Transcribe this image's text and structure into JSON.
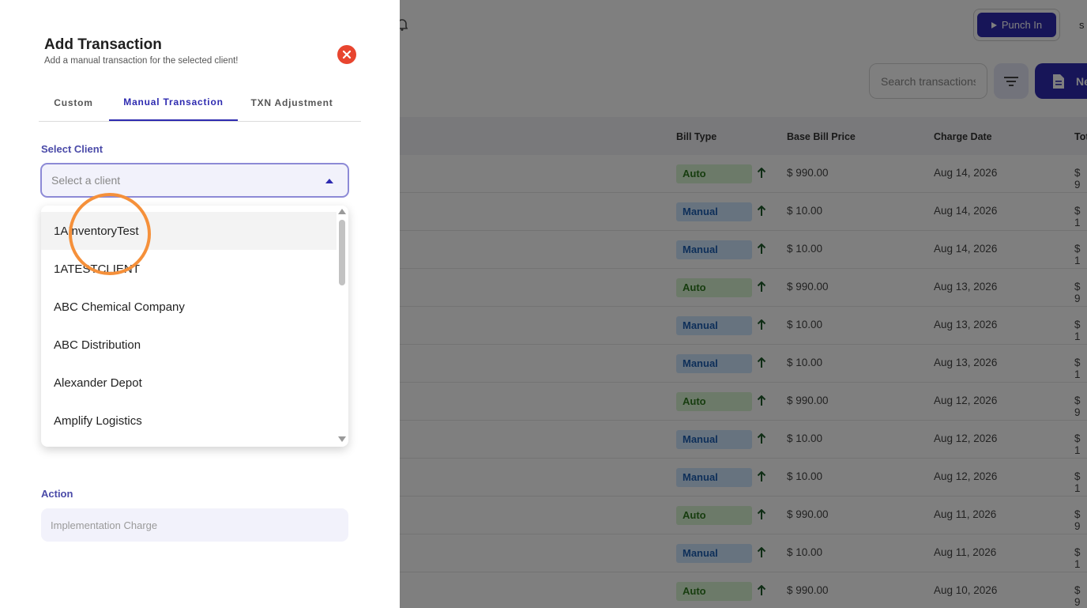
{
  "background_app": {
    "punch_in_label": "Punch In",
    "user_initial": "s",
    "search_placeholder": "Search transactions",
    "new_button_label": "New",
    "columns": [
      "Bill Type",
      "Base Bill Price",
      "Charge Date",
      "Total"
    ],
    "rows": [
      {
        "bill_type": "Auto",
        "price": "$ 990.00",
        "date": "Aug 14, 2026",
        "total": "$ 9"
      },
      {
        "bill_type": "Manual",
        "price": "$ 10.00",
        "date": "Aug 14, 2026",
        "total": "$ 1"
      },
      {
        "bill_type": "Manual",
        "price": "$ 10.00",
        "date": "Aug 14, 2026",
        "total": "$ 1"
      },
      {
        "bill_type": "Auto",
        "price": "$ 990.00",
        "date": "Aug 13, 2026",
        "total": "$ 9"
      },
      {
        "bill_type": "Manual",
        "price": "$ 10.00",
        "date": "Aug 13, 2026",
        "total": "$ 1"
      },
      {
        "bill_type": "Manual",
        "price": "$ 10.00",
        "date": "Aug 13, 2026",
        "total": "$ 1"
      },
      {
        "bill_type": "Auto",
        "price": "$ 990.00",
        "date": "Aug 12, 2026",
        "total": "$ 9"
      },
      {
        "bill_type": "Manual",
        "price": "$ 10.00",
        "date": "Aug 12, 2026",
        "total": "$ 1"
      },
      {
        "bill_type": "Manual",
        "price": "$ 10.00",
        "date": "Aug 12, 2026",
        "total": "$ 1"
      },
      {
        "bill_type": "Auto",
        "price": "$ 990.00",
        "date": "Aug 11, 2026",
        "total": "$ 9"
      },
      {
        "bill_type": "Manual",
        "price": "$ 10.00",
        "date": "Aug 11, 2026",
        "total": "$ 1"
      },
      {
        "bill_type": "Auto",
        "price": "$ 990.00",
        "date": "Aug 10, 2026",
        "total": "$ 9"
      }
    ]
  },
  "drawer": {
    "title": "Add Transaction",
    "subtitle": "Add a manual transaction for the selected client!",
    "tabs": [
      {
        "label": "Custom",
        "active": false
      },
      {
        "label": "Manual Transaction",
        "active": true
      },
      {
        "label": "TXN Adjustment",
        "active": false
      }
    ],
    "select_client": {
      "label": "Select Client",
      "placeholder": "Select a client",
      "options": [
        "1AInventoryTest",
        "1ATESTCLIENT",
        "ABC Chemical Company",
        "ABC Distribution",
        "Alexander Depot",
        "Amplify Logistics"
      ],
      "highlighted_index": 0
    },
    "action": {
      "label": "Action",
      "placeholder": "Implementation Charge"
    }
  },
  "colors": {
    "primary": "#2e2bb0",
    "close": "#e8452f",
    "auto_badge": "#d9f4d3",
    "manual_badge": "#cfe6ff",
    "click_indicator": "#f5903a"
  }
}
